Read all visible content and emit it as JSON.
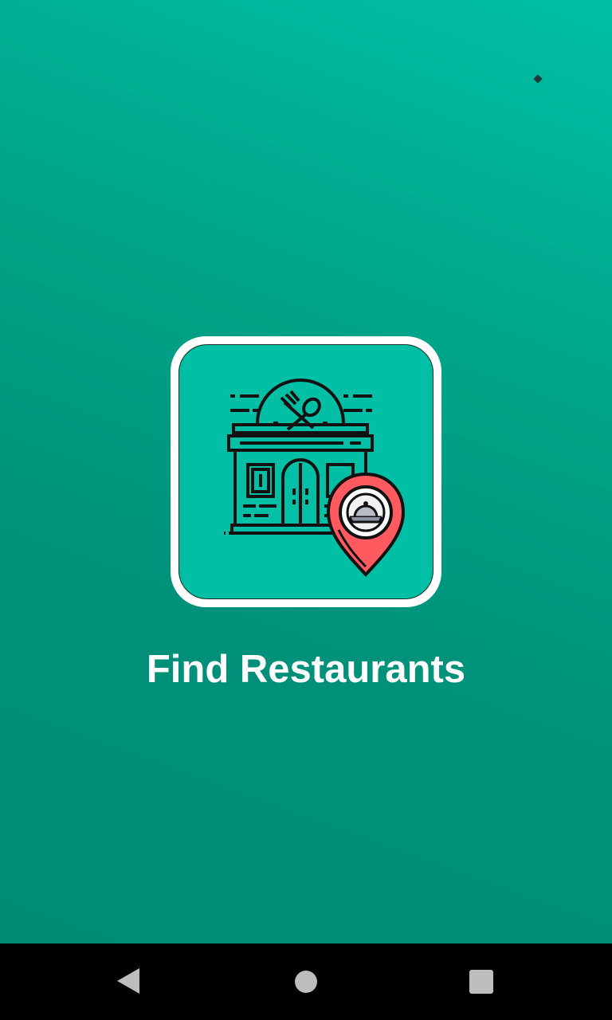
{
  "app": {
    "title": "Find Restaurants"
  },
  "logo": {
    "icon": "restaurant-location-icon",
    "frame_color": "#ffffff",
    "background_color": "#00bfa5",
    "pin_color": "#ff5a5f"
  },
  "navigation": {
    "back_icon": "back-triangle-icon",
    "home_icon": "home-circle-icon",
    "recents_icon": "recents-square-icon"
  },
  "colors": {
    "background_top": "#00bfa5",
    "background_bottom": "#008c72",
    "nav_bar": "#000000",
    "nav_icons": "#bdbdbd",
    "title_text": "#ffffff"
  }
}
